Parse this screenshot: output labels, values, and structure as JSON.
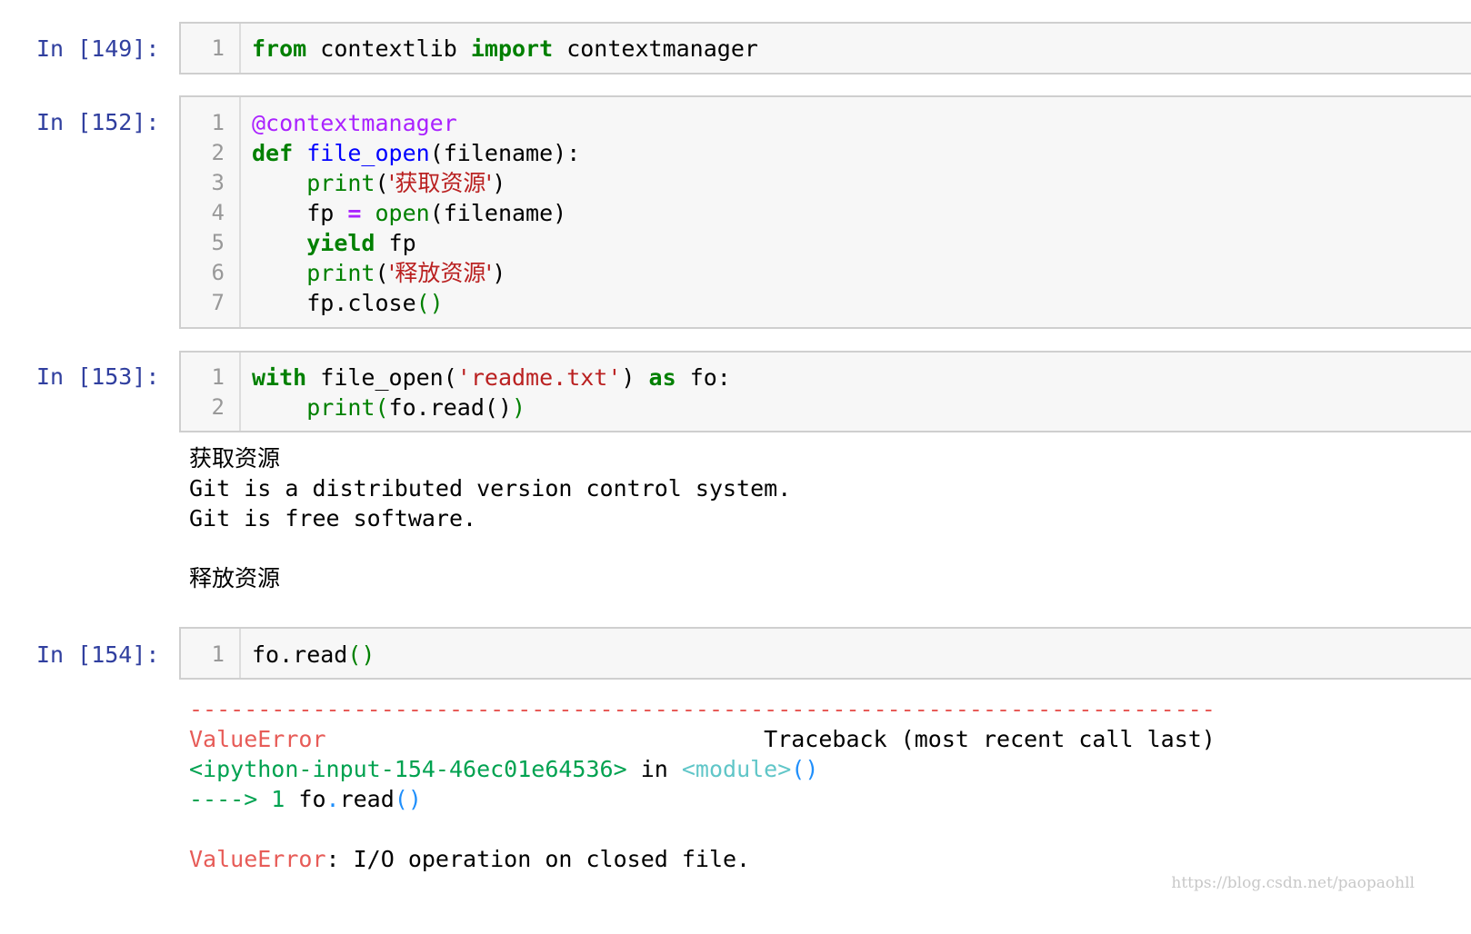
{
  "cells": [
    {
      "prompt": "In [149]:",
      "line_numbers": [
        "1"
      ],
      "lines": [
        [
          {
            "t": "from",
            "c": "kw"
          },
          {
            "t": " contextlib ",
            "c": ""
          },
          {
            "t": "import",
            "c": "kw"
          },
          {
            "t": " contextmanager",
            "c": ""
          }
        ]
      ]
    },
    {
      "prompt": "In [152]:",
      "line_numbers": [
        "1",
        "2",
        "3",
        "4",
        "5",
        "6",
        "7"
      ],
      "lines": [
        [
          {
            "t": "@contextmanager",
            "c": "deco"
          }
        ],
        [
          {
            "t": "def",
            "c": "kw"
          },
          {
            "t": " ",
            "c": ""
          },
          {
            "t": "file_open",
            "c": "fn"
          },
          {
            "t": "(filename):",
            "c": ""
          }
        ],
        [
          {
            "t": "    ",
            "c": ""
          },
          {
            "t": "print",
            "c": "bi"
          },
          {
            "t": "(",
            "c": ""
          },
          {
            "t": "'获取资源'",
            "c": "str"
          },
          {
            "t": ")",
            "c": ""
          }
        ],
        [
          {
            "t": "    fp ",
            "c": ""
          },
          {
            "t": "=",
            "c": "op"
          },
          {
            "t": " ",
            "c": ""
          },
          {
            "t": "open",
            "c": "bi"
          },
          {
            "t": "(filename)",
            "c": ""
          }
        ],
        [
          {
            "t": "    ",
            "c": ""
          },
          {
            "t": "yield",
            "c": "kw"
          },
          {
            "t": " fp",
            "c": ""
          }
        ],
        [
          {
            "t": "    ",
            "c": ""
          },
          {
            "t": "print",
            "c": "bi"
          },
          {
            "t": "(",
            "c": ""
          },
          {
            "t": "'释放资源'",
            "c": "str"
          },
          {
            "t": ")",
            "c": ""
          }
        ],
        [
          {
            "t": "    fp.close",
            "c": ""
          },
          {
            "t": "()",
            "c": "pgreen"
          }
        ]
      ]
    },
    {
      "prompt": "In [153]:",
      "line_numbers": [
        "1",
        "2"
      ],
      "lines": [
        [
          {
            "t": "with",
            "c": "kw"
          },
          {
            "t": " file_open(",
            "c": ""
          },
          {
            "t": "'readme.txt'",
            "c": "str"
          },
          {
            "t": ") ",
            "c": ""
          },
          {
            "t": "as",
            "c": "kw"
          },
          {
            "t": " fo:",
            "c": ""
          }
        ],
        [
          {
            "t": "    ",
            "c": ""
          },
          {
            "t": "print",
            "c": "bi"
          },
          {
            "t": "(",
            "c": "pgreen"
          },
          {
            "t": "fo.read()",
            "c": ""
          },
          {
            "t": ")",
            "c": "pgreen"
          }
        ]
      ],
      "output": [
        "获取资源",
        "Git is a distributed version control system.",
        "Git is free software.",
        "",
        "释放资源"
      ]
    },
    {
      "prompt": "In [154]:",
      "line_numbers": [
        "1"
      ],
      "lines": [
        [
          {
            "t": "fo.read",
            "c": ""
          },
          {
            "t": "()",
            "c": "pgreen"
          }
        ]
      ],
      "traceback": [
        [
          {
            "t": "---------------------------------------------------------------------------",
            "c": "err-red"
          }
        ],
        [
          {
            "t": "ValueError",
            "c": "err-red"
          },
          {
            "t": "                                Traceback (most recent call last)",
            "c": ""
          }
        ],
        [
          {
            "t": "<ipython-input-154-46ec01e64536>",
            "c": "err-green"
          },
          {
            "t": " in ",
            "c": ""
          },
          {
            "t": "<module>",
            "c": "err-cyan"
          },
          {
            "t": "()",
            "c": "err-blue"
          }
        ],
        [
          {
            "t": "----> 1",
            "c": "err-green"
          },
          {
            "t": " fo",
            "c": ""
          },
          {
            "t": ".",
            "c": "err-blue"
          },
          {
            "t": "read",
            "c": ""
          },
          {
            "t": "()",
            "c": "err-blue"
          }
        ],
        [
          {
            "t": "",
            "c": ""
          }
        ],
        [
          {
            "t": "ValueError",
            "c": "err-red"
          },
          {
            "t": ": I/O operation on closed file.",
            "c": ""
          }
        ]
      ]
    }
  ],
  "watermark": "https://blog.csdn.net/paopaohll",
  "colors": {
    "prompt": "#303f9f",
    "keyword": "#008000",
    "string": "#ba2121",
    "decorator": "#aa22ff",
    "function": "#0000ff",
    "error_red": "#e75c58",
    "error_green": "#00a250"
  }
}
